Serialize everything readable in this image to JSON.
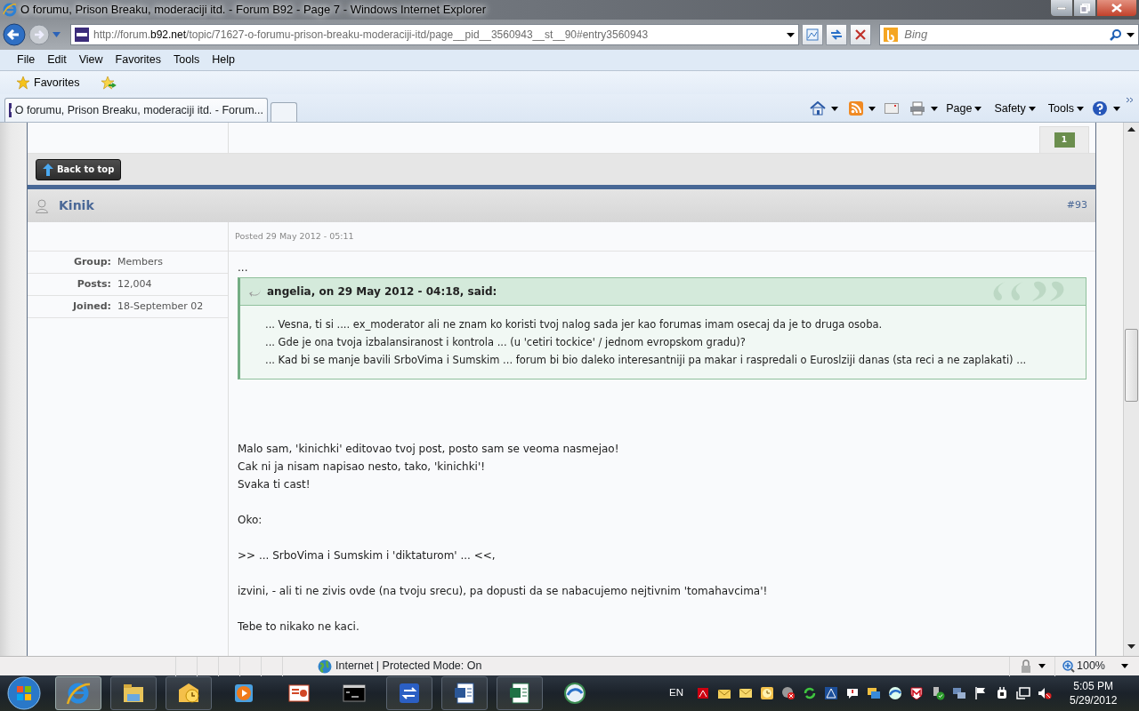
{
  "window": {
    "title": "O forumu, Prison Breaku, moderaciji itd. - Forum B92 - Page 7 - Windows Internet Explorer"
  },
  "address_bar": {
    "url_parts": [
      "http://forum.",
      "b92.net",
      "/topic/71627-o-forumu-prison-breaku-moderaciji-itd/page__pid__3560943__st__90#entry3560943"
    ]
  },
  "search": {
    "placeholder": "Bing"
  },
  "menu": [
    "File",
    "Edit",
    "View",
    "Favorites",
    "Tools",
    "Help"
  ],
  "favorites_bar": {
    "label": "Favorites"
  },
  "tabs": [
    {
      "label": "O forumu, Prison Breaku, moderaciji itd. - Forum...",
      "selected": true
    }
  ],
  "command_bar": [
    "Page",
    "Safety",
    "Tools"
  ],
  "pagination": [
    {
      "label": "1",
      "selected": true
    }
  ],
  "back_to_top": "Back to top",
  "post": {
    "author": "Kinik",
    "number": "#93",
    "posted": "Posted 29 May 2012 - 05:11",
    "author_info": [
      {
        "label": "Group:",
        "value": "Members"
      },
      {
        "label": "Posts:",
        "value": "12,004"
      },
      {
        "label": "Joined:",
        "value": "18-September 02"
      }
    ],
    "lead": "...",
    "quote": {
      "citation": "angelia, on 29 May 2012 - 04:18, said:",
      "lines": [
        "... Vesna, ti si .... ex_moderator ali ne znam ko koristi tvoj nalog sada jer kao forumas imam osecaj da je to druga osoba.",
        "... Gde je ona tvoja izbalansiranost i kontrola ... (u 'cetiri tockice' / jednom evropskom gradu)?",
        "... Kad bi se manje bavili SrboVima i Sumskim ... forum bi bio daleko interesantniji pa makar i raspredali o Euroslziji danas (sta reci a ne zaplakati) ..."
      ]
    },
    "paragraphs": [
      [
        "Malo sam, 'kinichki' editovao tvoj post, posto sam se veoma nasmejao!",
        "Cak ni ja nisam napisao nesto, tako, 'kinichki'!",
        "Svaka ti cast!"
      ],
      [
        "Oko:"
      ],
      [
        ">> ... SrboVima i Sumskim i 'diktaturom' ... <<,"
      ],
      [
        "izvini, - ali ti ne zivis ovde (na tvoju srecu), pa dopusti da se nabacujemo nejtivnim 'tomahavcima'!"
      ],
      [
        "Tebe to nikako ne kaci."
      ]
    ]
  },
  "status_bar": {
    "zone": "Internet | Protected Mode: On",
    "zoom": "100%"
  },
  "taskbar": {
    "buttons": [
      {
        "running": true,
        "selected": true
      },
      {
        "running": true,
        "selected": false
      },
      {
        "running": true,
        "selected": false
      },
      {
        "running": false,
        "selected": false
      },
      {
        "running": false,
        "selected": false
      },
      {
        "running": false,
        "selected": false
      },
      {
        "running": true,
        "selected": false
      },
      {
        "running": true,
        "selected": false
      },
      {
        "running": true,
        "selected": false
      },
      {
        "running": false,
        "selected": false
      }
    ],
    "language": "EN",
    "time": "5:05 PM",
    "date": "5/29/2012"
  }
}
